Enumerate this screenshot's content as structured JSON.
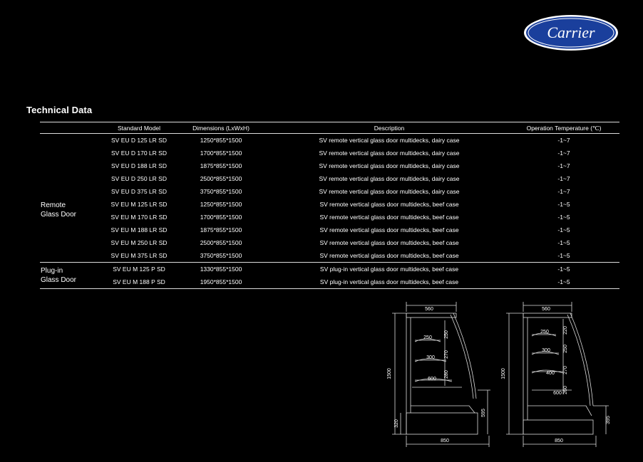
{
  "brand": {
    "logo_text": "Carrier",
    "logo_color": "#1a3f9c"
  },
  "section_title": "Technical Data",
  "table": {
    "headers": {
      "model": "Standard Model",
      "dimensions": "Dimensions (LxWxH)",
      "description": "Description",
      "temperature": "Operation Temperature (℃)"
    },
    "groups": [
      {
        "label_line1": "Remote",
        "label_line2": "Glass Door",
        "rows": [
          {
            "model": "SV EU D 125 LR SD",
            "dim": "1250*855*1500",
            "desc": "SV remote vertical glass door multidecks, dairy case",
            "temp": "-1~7"
          },
          {
            "model": "SV EU D 170 LR SD",
            "dim": "1700*855*1500",
            "desc": "SV remote vertical glass door multidecks, dairy case",
            "temp": "-1~7"
          },
          {
            "model": "SV EU D 188 LR SD",
            "dim": "1875*855*1500",
            "desc": "SV remote vertical glass door multidecks, dairy case",
            "temp": "-1~7"
          },
          {
            "model": "SV EU D 250 LR SD",
            "dim": "2500*855*1500",
            "desc": "SV remote vertical glass door multidecks, dairy case",
            "temp": "-1~7"
          },
          {
            "model": "SV EU D 375 LR SD",
            "dim": "3750*855*1500",
            "desc": "SV remote vertical glass door multidecks, dairy case",
            "temp": "-1~7"
          },
          {
            "model": "SV EU M 125 LR SD",
            "dim": "1250*855*1500",
            "desc": "SV remote vertical glass door multidecks, beef case",
            "temp": "-1~5"
          },
          {
            "model": "SV EU M 170 LR SD",
            "dim": "1700*855*1500",
            "desc": "SV remote vertical glass door multidecks, beef case",
            "temp": "-1~5"
          },
          {
            "model": "SV EU M 188 LR SD",
            "dim": "1875*855*1500",
            "desc": "SV remote vertical glass door multidecks, beef case",
            "temp": "-1~5"
          },
          {
            "model": "SV EU M 250 LR SD",
            "dim": "2500*855*1500",
            "desc": "SV remote vertical glass door multidecks, beef case",
            "temp": "-1~5"
          },
          {
            "model": "SV EU M 375 LR SD",
            "dim": "3750*855*1500",
            "desc": "SV remote vertical glass door multidecks, beef case",
            "temp": "-1~5"
          }
        ]
      },
      {
        "label_line1": "Plug-in",
        "label_line2": "Glass Door",
        "rows": [
          {
            "model": "SV EU M 125 P SD",
            "dim": "1330*855*1500",
            "desc": "SV plug-in vertical glass door multidecks, beef case",
            "temp": "-1~5"
          },
          {
            "model": "SV EU M 188 P SD",
            "dim": "1950*855*1500",
            "desc": "SV plug-in vertical glass door multidecks, beef case",
            "temp": "-1~5"
          }
        ]
      }
    ]
  },
  "diagrams": [
    {
      "top_width": "560",
      "height": "1500",
      "base_width": "850",
      "shelf_widths": [
        "250",
        "300",
        "600"
      ],
      "shelf_gaps": [
        "250",
        "270",
        "280"
      ],
      "front_height": "595",
      "base_height": "320"
    },
    {
      "top_width": "560",
      "height": "1500",
      "base_width": "850",
      "shelf_widths": [
        "250",
        "300",
        "400",
        "600"
      ],
      "shelf_gaps": [
        "220",
        "250",
        "270",
        "260"
      ],
      "front_height": "395"
    }
  ]
}
